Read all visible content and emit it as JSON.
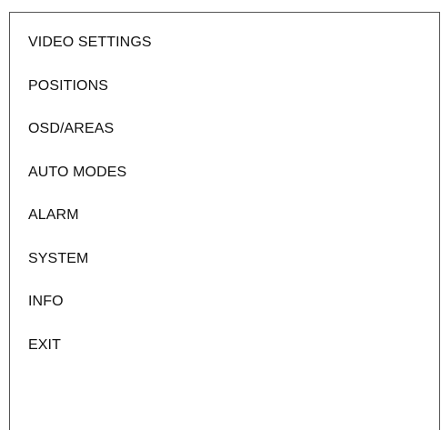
{
  "menu": {
    "items": [
      {
        "label": "VIDEO SETTINGS"
      },
      {
        "label": "POSITIONS"
      },
      {
        "label": "OSD/AREAS"
      },
      {
        "label": "AUTO MODES"
      },
      {
        "label": "ALARM"
      },
      {
        "label": "SYSTEM"
      },
      {
        "label": "INFO"
      },
      {
        "label": "EXIT"
      }
    ]
  }
}
